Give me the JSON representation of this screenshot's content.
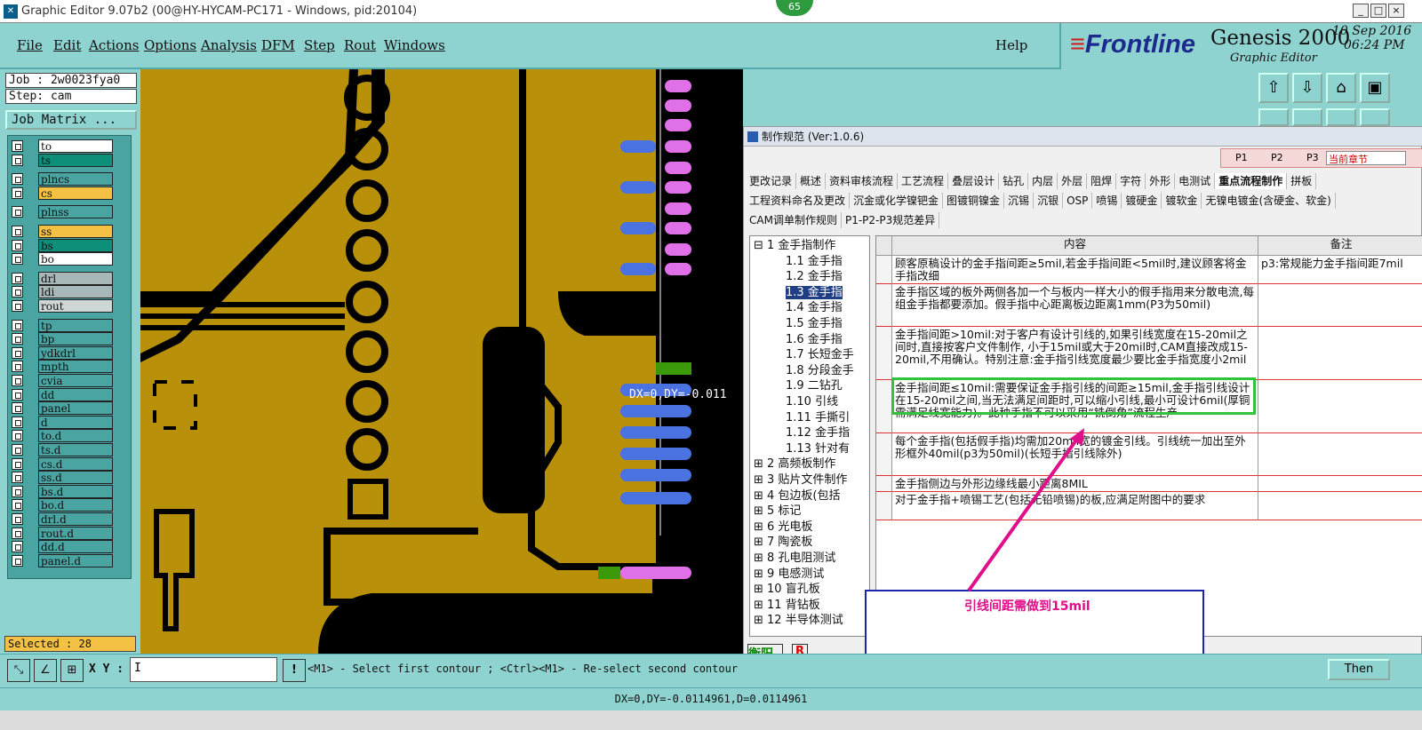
{
  "window": {
    "title": "Graphic Editor 9.07b2 (00@HY-HYCAM-PC171 - Windows, pid:20104)",
    "badge": "65",
    "controls": [
      "_",
      "□",
      "×"
    ]
  },
  "menu": {
    "items": [
      "File",
      "Edit",
      "Actions",
      "Options",
      "Analysis",
      "DFM",
      "Step",
      "Rout",
      "Windows"
    ],
    "help": "Help"
  },
  "brand": {
    "logo_main": "Frontline",
    "product": "Genesis 2000",
    "subtitle": "Graphic Editor",
    "date": "10 Sep 2016",
    "time": "06:24 PM"
  },
  "job": {
    "job": "Job : 2w0023fya0",
    "step": "Step: cam",
    "matrix_button": "Job Matrix ..."
  },
  "layers": [
    {
      "name": "to",
      "color": "#ffffff"
    },
    {
      "name": "ts",
      "color": "#0e8f7a"
    },
    {
      "name": "plncs",
      "color": "#4aa5a2"
    },
    {
      "name": "cs",
      "color": "#f4c144"
    },
    {
      "name": "plnss",
      "color": "#4aa5a2"
    },
    {
      "name": "ss",
      "color": "#f4c144"
    },
    {
      "name": "bs",
      "color": "#0e8f7a"
    },
    {
      "name": "bo",
      "color": "#ffffff"
    },
    {
      "name": "drl",
      "color": "#a8b7b8"
    },
    {
      "name": "ldi",
      "color": "#a8b7b8"
    },
    {
      "name": "rout",
      "color": "#cfd6d6"
    },
    {
      "name": "tp",
      "color": "#4aa5a2"
    },
    {
      "name": "bp",
      "color": "#4aa5a2"
    },
    {
      "name": "ydkdrl",
      "color": "#4aa5a2"
    },
    {
      "name": "mpth",
      "color": "#4aa5a2"
    },
    {
      "name": "cvia",
      "color": "#4aa5a2"
    },
    {
      "name": "dd",
      "color": "#4aa5a2"
    },
    {
      "name": "panel",
      "color": "#4aa5a2"
    },
    {
      "name": "d",
      "color": "#4aa5a2"
    },
    {
      "name": "to.d",
      "color": "#4aa5a2"
    },
    {
      "name": "ts.d",
      "color": "#4aa5a2"
    },
    {
      "name": "cs.d",
      "color": "#4aa5a2"
    },
    {
      "name": "ss.d",
      "color": "#4aa5a2"
    },
    {
      "name": "bs.d",
      "color": "#4aa5a2"
    },
    {
      "name": "bo.d",
      "color": "#4aa5a2"
    },
    {
      "name": "drl.d",
      "color": "#4aa5a2"
    },
    {
      "name": "rout.d",
      "color": "#4aa5a2"
    },
    {
      "name": "dd.d",
      "color": "#4aa5a2"
    },
    {
      "name": "panel.d",
      "color": "#4aa5a2"
    }
  ],
  "selected": "Selected : 28",
  "canvas": {
    "measure_text": "DX=0,DY=-0.011"
  },
  "bottom": {
    "xy_label": "X Y :",
    "xy_value": "I",
    "alert": "!",
    "hint": "<M1> - Select first contour ; <Ctrl><M1> - Re-select second contour",
    "then": "Then",
    "status": "DX=0,DY=-0.0114961,D=0.0114961"
  },
  "dialog": {
    "title": "制作规范 (Ver:1.0.6)",
    "filters": [
      "P1",
      "P2",
      "P3"
    ],
    "chapter": "当前章节",
    "tabs_row1": [
      "更改记录",
      "概述",
      "资料审核流程",
      "工艺流程",
      "叠层设计",
      "钻孔",
      "内层",
      "外层",
      "阻焊",
      "字符",
      "外形",
      "电测试",
      "重点流程制作",
      "拼板"
    ],
    "tabs_row2": [
      "工程资料命名及更改",
      "沉金或化学镍钯金",
      "图镀铜镍金",
      "沉锡",
      "沉银",
      "OSP",
      "喷锡",
      "镀硬金",
      "镀软金",
      "无镍电镀金(含硬金、软金)"
    ],
    "tabs_row3": [
      "CAM调单制作规则",
      "P1-P2-P3规范差异"
    ],
    "tree": [
      "1 金手指制作",
      "1.1 金手指",
      "1.2 金手指",
      "1.3 金手指",
      "1.4 金手指",
      "1.5 金手指",
      "1.6 金手指",
      "1.7 长短金手",
      "1.8 分段金手",
      "1.9 二钻孔",
      "1.10 引线",
      "1.11 手撕引",
      "1.12 金手指",
      "1.13 针对有",
      "2 高频板制作",
      "3 贴片文件制作",
      "4 包边板(包括",
      "5 标记",
      "6 光电板",
      "7 陶瓷板",
      "8 孔电阻测试",
      "9 电感测试",
      "10 盲孔板",
      "11 背钻板",
      "12 半导体测试"
    ],
    "grid_headers": [
      "内容",
      "备注"
    ],
    "rows": [
      {
        "content": "顾客原稿设计的金手指间距≥5mil,若金手指间距<5mil时,建议顾客将金手指改细",
        "note": "p3:常规能力金手指间距7mil"
      },
      {
        "content": "金手指区域的板外两侧各加一个与板内一样大小的假手指用来分散电流,每组金手指都要添加。假手指中心距离板边距离1mm(P3为50mil)",
        "note": ""
      },
      {
        "content": "金手指间距>10mil:对于客户有设计引线的,如果引线宽度在15-20mil之间时,直接按客户文件制作, 小于15mil或大于20mil时,CAM直接改成15-20mil,不用确认。特别注意:金手指引线宽度最少要比金手指宽度小2mil",
        "note": ""
      },
      {
        "content": "金手指间距≤10mil:需要保证金手指引线的间距≥15mil,金手指引线设计在15-20mil之间,当无法满足间距时,可以缩小引线,最小可设计6mil(厚铜需满足线宽能力)。此种手指不可以采用“铣倒角”流程生产",
        "note": ""
      },
      {
        "content": "每个金手指(包括假手指)均需加20mil宽的镀金引线。引线统一加出至外形框外40mil(p3为50mil)(长短手指引线除外)",
        "note": ""
      },
      {
        "content": "金手指侧边与外形边缘线最小距离8MIL",
        "note": ""
      },
      {
        "content": "对于金手指+喷锡工艺(包括无铅喷锡)的板,应满足附图中的要求",
        "note": ""
      }
    ],
    "footer_left": "衡阳",
    "footer_r": "R"
  },
  "annotation": {
    "text": "引线间距需做到15mil",
    "color": "#e0108a"
  }
}
